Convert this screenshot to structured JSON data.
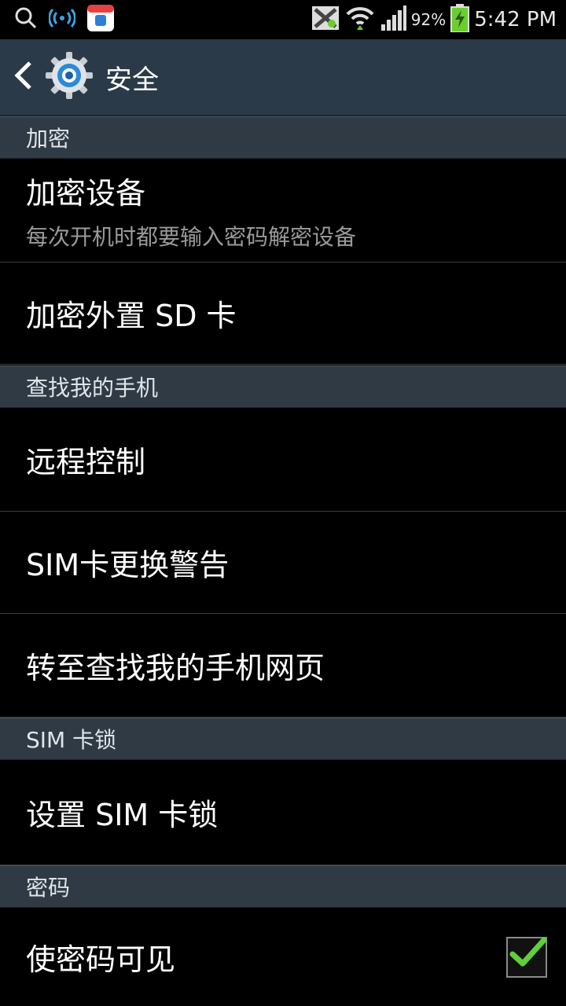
{
  "status_bar": {
    "battery_percent": "92%",
    "time": "5:42 PM",
    "icons": [
      "search-icon",
      "wifi-hotspot-icon",
      "app-store-icon",
      "blocked-icon",
      "wifi-icon",
      "signal-icon",
      "battery-charging-icon"
    ]
  },
  "action_bar": {
    "title": "安全",
    "icons": [
      "back-arrow-icon",
      "settings-gear-icon"
    ]
  },
  "sections": [
    {
      "header": "加密",
      "items": [
        {
          "title": "加密设备",
          "subtitle": "每次开机时都要输入密码解密设备"
        },
        {
          "title": "加密外置 SD 卡"
        }
      ]
    },
    {
      "header": "查找我的手机",
      "items": [
        {
          "title": "远程控制"
        },
        {
          "title": "SIM卡更换警告"
        },
        {
          "title": "转至查找我的手机网页"
        }
      ]
    },
    {
      "header": "SIM 卡锁",
      "items": [
        {
          "title": "设置 SIM 卡锁"
        }
      ]
    },
    {
      "header": "密码",
      "items": [
        {
          "title": "使密码可见",
          "checked": true
        }
      ]
    }
  ],
  "colors": {
    "action_bar_bg": "#2b3a48",
    "header_bg": "#2f3a44",
    "check_green": "#5fd03a",
    "battery_green": "#6ccd2f"
  }
}
